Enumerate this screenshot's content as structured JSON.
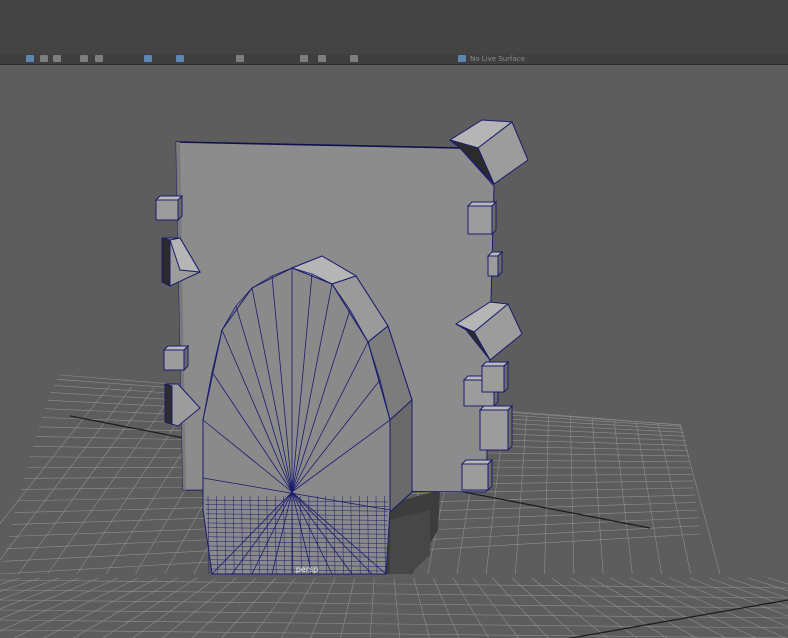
{
  "viewport": {
    "camera_label": "persp"
  },
  "toolbar": {
    "status_text": "No Live Surface",
    "icons": [
      {
        "name": "select-mode-icon",
        "active": true
      },
      {
        "name": "lasso-icon",
        "active": false
      },
      {
        "name": "paint-select-icon",
        "active": false
      },
      {
        "name": "snap-grid-icon",
        "active": false
      },
      {
        "name": "snap-curve-icon",
        "active": false
      },
      {
        "name": "snap-point-icon",
        "active": true
      },
      {
        "name": "snap-view-icon",
        "active": true
      },
      {
        "name": "history-icon",
        "active": false
      },
      {
        "name": "render-icon",
        "active": false
      },
      {
        "name": "ipr-icon",
        "active": false
      },
      {
        "name": "render-settings-icon",
        "active": false
      },
      {
        "name": "live-surface-icon",
        "active": true
      }
    ]
  },
  "colors": {
    "background": "#5d5d5d",
    "grid": "#8f8f8f",
    "wire": "#1b1b6e",
    "face": "#8c8c8c",
    "face_dark": "#555555",
    "selection": "#5d86b5"
  }
}
